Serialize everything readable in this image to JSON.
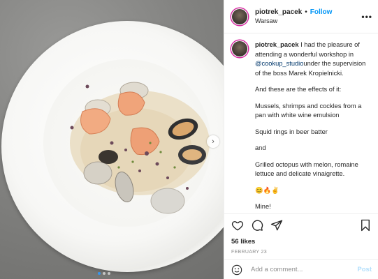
{
  "header": {
    "username": "piotrek_pacek",
    "separator": "•",
    "follow_label": "Follow",
    "location": "Warsaw",
    "more_icon": "more-horizontal-icon"
  },
  "caption": {
    "username": "piotrek_pacek",
    "intro": "I had the pleasure of attending a wonderful workshop in",
    "mention": "@cookup_studio",
    "intro_rest": "under the supervision of the boss Marek Kropielnicki.",
    "paragraphs": [
      "And these are the effects of it:",
      "Mussels, shrimps and cockles from a pan with white wine emulsion",
      "Squid rings in beer batter",
      "and",
      "Grilled octopus with melon, romaine lettuce and delicate vinaigrette.",
      "😊🔥✌",
      "Mine!"
    ]
  },
  "actions": {
    "like_icon": "heart-icon",
    "comment_icon": "comment-icon",
    "share_icon": "paper-plane-icon",
    "save_icon": "bookmark-icon",
    "likes": "56 likes",
    "date": "FEBRUARY 23"
  },
  "comment_bar": {
    "emoji_icon": "smiley-icon",
    "placeholder": "Add a comment...",
    "post_label": "Post"
  },
  "carousel": {
    "next_icon": "chevron-right-icon",
    "total_slides": 3,
    "active_slide": 1
  }
}
